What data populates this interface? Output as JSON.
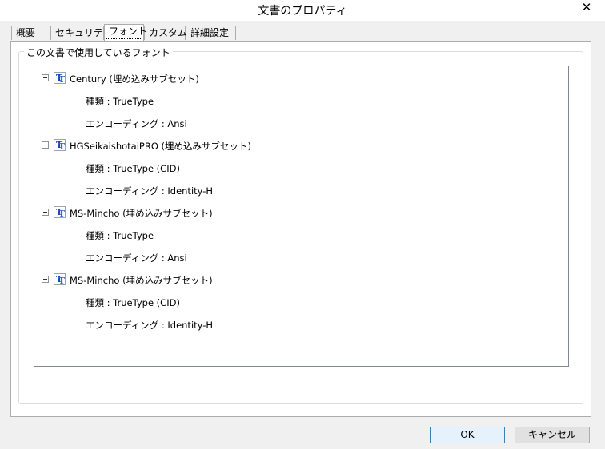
{
  "window": {
    "title": "文書のプロパティ",
    "close_glyph": "✕"
  },
  "tabs": [
    {
      "label": "概要"
    },
    {
      "label": "セキュリティ"
    },
    {
      "label": "フォント",
      "active": true
    },
    {
      "label": "カスタム"
    },
    {
      "label": "詳細設定"
    }
  ],
  "fonts_group": {
    "label": "この文書で使用しているフォント",
    "fonts": [
      {
        "name": "Century (埋め込みサブセット)",
        "type": "種類 : TrueType",
        "encoding": "エンコーディング : Ansi"
      },
      {
        "name": "HGSeikaishotaiPRO (埋め込みサブセット)",
        "type": "種類 : TrueType (CID)",
        "encoding": "エンコーディング : Identity-H"
      },
      {
        "name": "MS-Mincho (埋め込みサブセット)",
        "type": "種類 : TrueType",
        "encoding": "エンコーディング : Ansi"
      },
      {
        "name": "MS-Mincho (埋め込みサブセット)",
        "type": "種類 : TrueType (CID)",
        "encoding": "エンコーディング : Identity-H"
      }
    ]
  },
  "icons": {
    "expander": "collapse-minus-icon",
    "font": "truetype-font-icon"
  },
  "buttons": {
    "ok": "OK",
    "cancel": "キャンセル"
  }
}
